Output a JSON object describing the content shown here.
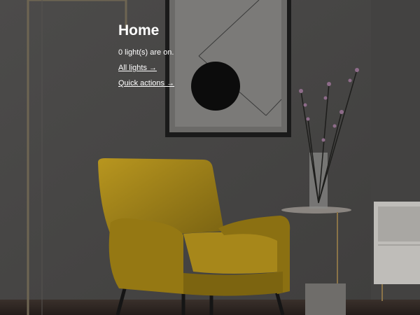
{
  "page": {
    "title": "Home",
    "status": "0 light(s) are on.",
    "links": [
      {
        "label": "All lights →"
      },
      {
        "label": "Quick actions →"
      }
    ]
  },
  "colors": {
    "wall": "#4a4948",
    "chair": "#a88a1f",
    "floor": "#2e2623",
    "text": "#ffffff"
  }
}
